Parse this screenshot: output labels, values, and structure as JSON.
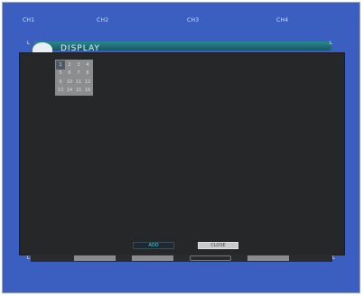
{
  "channel_headers": [
    "CH1",
    "CH2",
    "CH3",
    "CH4"
  ],
  "menu": {
    "title": "DISPLAY"
  },
  "channel_grid": {
    "cells": [
      "1",
      "2",
      "3",
      "4",
      "5",
      "6",
      "7",
      "8",
      "9",
      "10",
      "11",
      "12",
      "13",
      "14",
      "15",
      "16"
    ],
    "selected": "1"
  },
  "buttons": {
    "add": "ADD",
    "close": "CLOSE"
  },
  "corner_marks": {
    "left": "L",
    "right": "L"
  },
  "colors": {
    "background_blue": "#3a5fc0",
    "panel_dark": "#262728",
    "add_text": "#4fd0e0"
  }
}
